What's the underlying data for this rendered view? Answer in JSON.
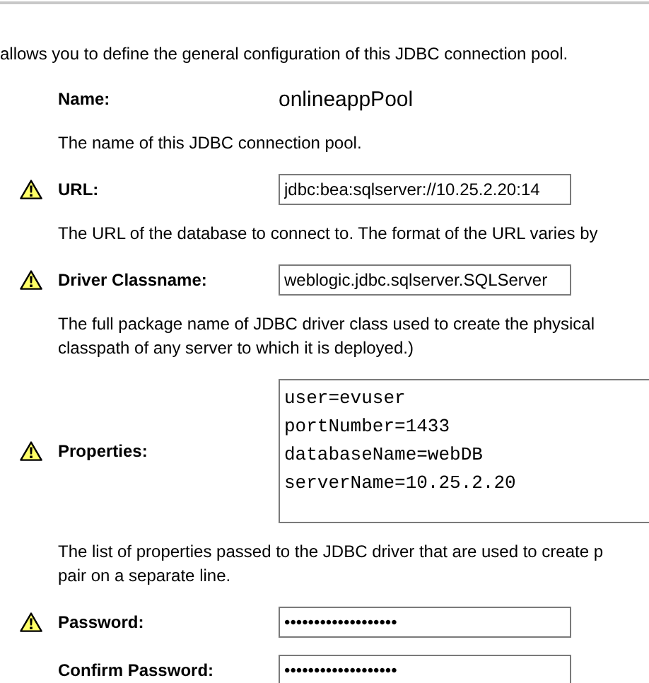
{
  "intro": "allows you to define the general configuration of this JDBC connection pool.",
  "fields": [
    {
      "kind": "static",
      "label": "Name:",
      "warning": false,
      "value": "onlineappPool",
      "description": [
        "The name of this JDBC connection pool."
      ]
    },
    {
      "kind": "input",
      "label": "URL:",
      "warning": true,
      "value": "jdbc:bea:sqlserver://10.25.2.20:14",
      "description": [
        "The URL of the database to connect to. The format of the URL varies by"
      ]
    },
    {
      "kind": "input",
      "label": "Driver Classname:",
      "warning": true,
      "value": "weblogic.jdbc.sqlserver.SQLServer",
      "description": [
        "The full package name of JDBC driver class used to create the physical",
        "classpath of any server to which it is deployed.)"
      ]
    },
    {
      "kind": "textarea",
      "label": "Properties:",
      "warning": true,
      "lines": [
        "user=evuser",
        "portNumber=1433",
        "databaseName=webDB",
        "serverName=10.25.2.20"
      ],
      "description": [
        "The list of properties passed to the JDBC driver that are used to create p",
        "pair on a separate line."
      ]
    },
    {
      "kind": "input",
      "label": "Password:",
      "warning": true,
      "value": "•••••••••••••••••••"
    },
    {
      "kind": "input",
      "label": "Confirm Password:",
      "warning": false,
      "value": "•••••••••••••••••••"
    }
  ]
}
